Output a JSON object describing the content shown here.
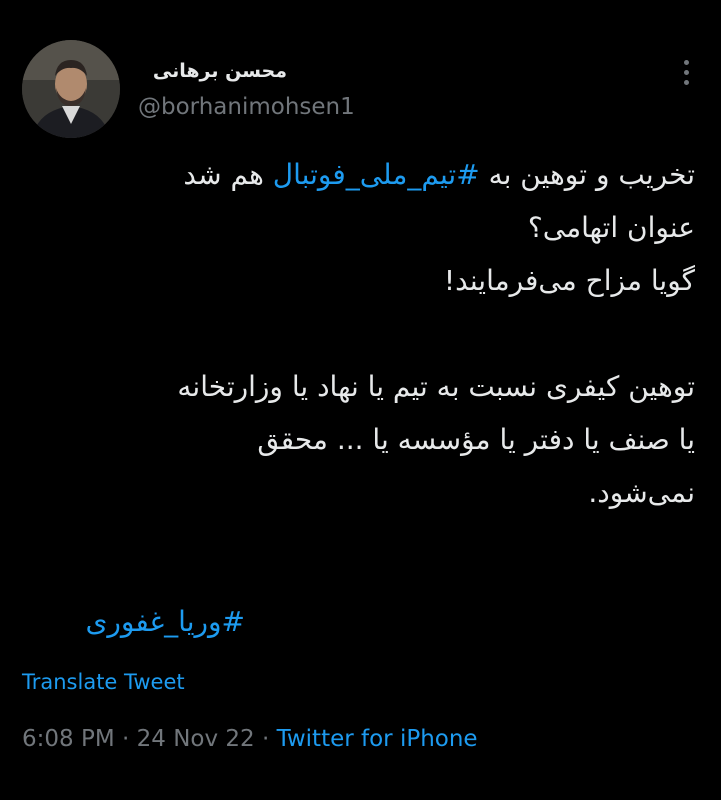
{
  "author": {
    "display_name": "محسن برهانی",
    "handle": "@borhanimohsen1"
  },
  "tweet": {
    "line1_pre": "تخریب و توهین به ",
    "line1_tag": "#تیم_ملی_فوتبال",
    "line1_post": " هم شد",
    "line2": "عنوان اتهامی؟",
    "line3": "گویا مزاح می‌فرمایند!",
    "line4": "توهین کیفری نسبت به تیم یا نهاد یا وزارتخانه",
    "line5": "یا صنف یا دفتر یا مؤسسه یا ... محقق",
    "line6": "نمی‌شود.",
    "hashtag": "#وریا_غفوری"
  },
  "translate_label": "Translate Tweet",
  "meta": {
    "time": "6:08 PM",
    "sep1": " · ",
    "date": "24 Nov 22",
    "sep2": " · ",
    "source": "Twitter for iPhone"
  },
  "colors": {
    "background": "#000000",
    "text": "#e7e9ea",
    "secondary": "#71767b",
    "link": "#1d9bf0"
  },
  "icons": {
    "more": "vertical-ellipsis-icon",
    "avatar": "profile-photo"
  }
}
